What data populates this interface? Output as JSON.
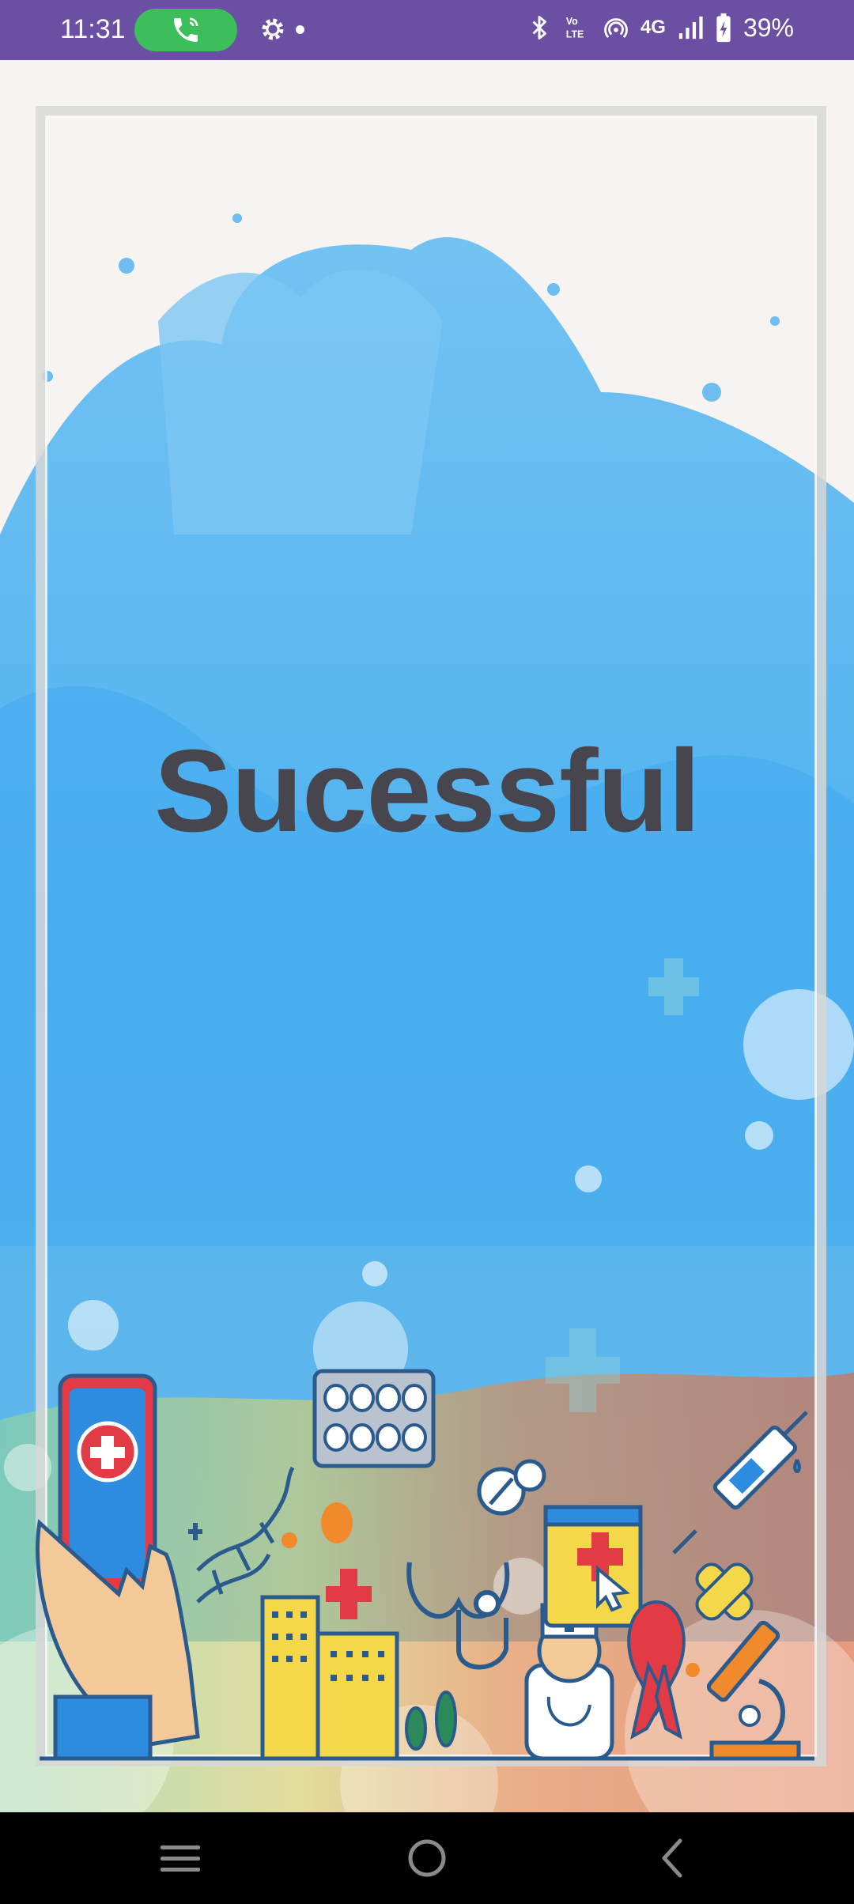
{
  "status_bar": {
    "time": "11:31",
    "network": "4G",
    "battery": "39%",
    "icons": [
      "phone-call-icon",
      "gear-icon",
      "bluetooth-icon",
      "volte-icon",
      "hotspot-icon",
      "signal-icon",
      "battery-charging-icon"
    ],
    "background_color": "#6a4fa3",
    "call_pill_color": "#3cbf5a"
  },
  "main": {
    "headline": "Sucessful",
    "headline_color": "#47464f",
    "splash_color": "#5bb8f0"
  },
  "nav_bar": {
    "buttons": [
      "menu-icon",
      "home-icon",
      "back-icon"
    ]
  }
}
